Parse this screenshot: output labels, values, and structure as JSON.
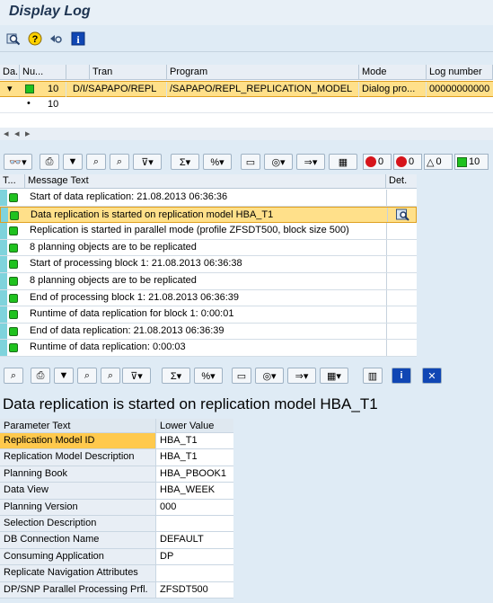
{
  "window": {
    "title": "Display Log"
  },
  "toolbar1": {
    "icons": [
      "find-icon",
      "help-icon",
      "back-glasses-icon",
      "info-icon"
    ]
  },
  "log_table": {
    "columns": [
      "Da...",
      "Nu...",
      "",
      "Tran",
      "Program",
      "Mode",
      "Log number"
    ],
    "rows": [
      {
        "expand": "▾",
        "light": "green",
        "number": "10",
        "tran": "D/I/SAPAPO/REPL",
        "program": "/SAPAPO/REPL_REPLICATION_MODEL",
        "mode": "Dialog pro...",
        "log_number": "00000000000"
      },
      {
        "expand": "•",
        "number": "10"
      }
    ]
  },
  "counters": {
    "stop": "0",
    "error": "0",
    "warning": "0",
    "success": "10"
  },
  "messages": {
    "columns": [
      "T...",
      "Message Text",
      "Det."
    ],
    "rows": [
      "Start of data replication: 21.08.2013 06:36:36",
      "Data replication is started on replication model HBA_T1",
      "Replication is started in parallel mode (profile ZFSDT500, block size 500)",
      "8 planning objects are to be replicated",
      "Start of processing block 1: 21.08.2013 06:36:38",
      "8 planning objects are to be replicated",
      "End of processing block 1: 21.08.2013 06:36:39",
      "Runtime of data replication for block 1: 0:00:01",
      "End of data replication: 21.08.2013 06:36:39",
      "Runtime of data replication: 0:00:03"
    ]
  },
  "detail": {
    "headline": "Data replication is started on replication model HBA_T1",
    "columns": [
      "Parameter Text",
      "Lower Value"
    ],
    "rows": [
      {
        "param": "Replication Model ID",
        "value": "HBA_T1"
      },
      {
        "param": "Replication Model Description",
        "value": "HBA_T1"
      },
      {
        "param": "Planning Book",
        "value": "HBA_PBOOK1"
      },
      {
        "param": "Data View",
        "value": "HBA_WEEK"
      },
      {
        "param": "Planning Version",
        "value": "000"
      },
      {
        "param": "Selection Description",
        "value": ""
      },
      {
        "param": "DB Connection Name",
        "value": "DEFAULT"
      },
      {
        "param": "Consuming Application",
        "value": "DP"
      },
      {
        "param": "Replicate Navigation Attributes",
        "value": ""
      },
      {
        "param": "DP/SNP Parallel Processing Prfl.",
        "value": "ZFSDT500"
      }
    ]
  }
}
